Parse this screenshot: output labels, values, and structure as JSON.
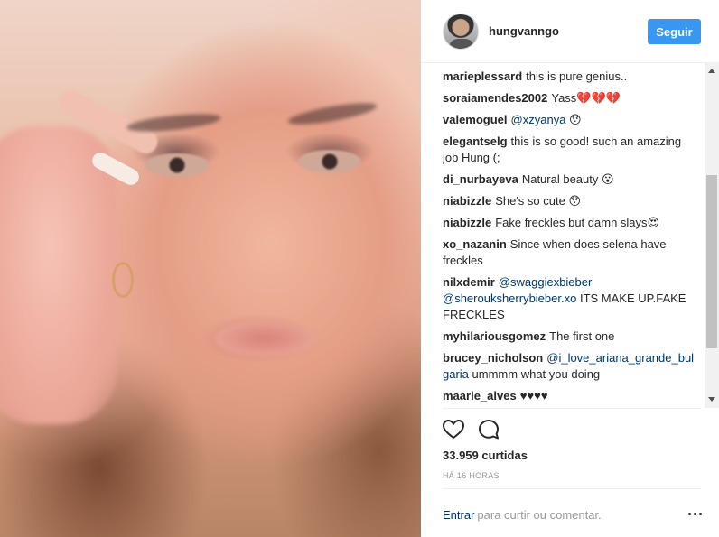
{
  "post": {
    "author": "hungvanngo",
    "follow_label": "Seguir"
  },
  "comments": [
    {
      "user": "marieplessard",
      "text": "this is pure genius.."
    },
    {
      "user": "soraiamendes2002",
      "text": "Yass💔💔💔"
    },
    {
      "user": "valemoguel",
      "mention": "@xzyanya",
      "text": "😯"
    },
    {
      "user": "elegantselg",
      "text": "this is so good! such an amazing job Hung (;"
    },
    {
      "user": "di_nurbayeva",
      "text": "Natural beauty 😮"
    },
    {
      "user": "niabizzle",
      "text": "She's so cute 😯"
    },
    {
      "user": "niabizzle",
      "text": "Fake freckles but damn slays😍"
    },
    {
      "user": "xo_nazanin",
      "text": "Since when does selena have freckles"
    },
    {
      "user": "nilxdemir",
      "mention": "@swaggiexbieber @sherouksherrybieber.xo",
      "text": "ITS MAKE UP.FAKE FRECKLES"
    },
    {
      "user": "myhilariousgomez",
      "text": "The first one"
    },
    {
      "user": "brucey_nicholson",
      "mention": "@i_love_ariana_grande_bulgaria",
      "text": "ummmm what you doing"
    },
    {
      "user": "maarie_alves",
      "text": "♥♥♥♥"
    }
  ],
  "actions": {
    "like_icon": "heart-icon",
    "comment_icon": "comment-bubble-icon"
  },
  "likes_text": "33.959 curtidas",
  "time_text": "HÁ 16 HORAS",
  "footer": {
    "login_link": "Entrar",
    "prompt": "para curtir ou comentar."
  },
  "colors": {
    "accent": "#3897f0",
    "mention": "#003569",
    "muted": "#999999"
  }
}
